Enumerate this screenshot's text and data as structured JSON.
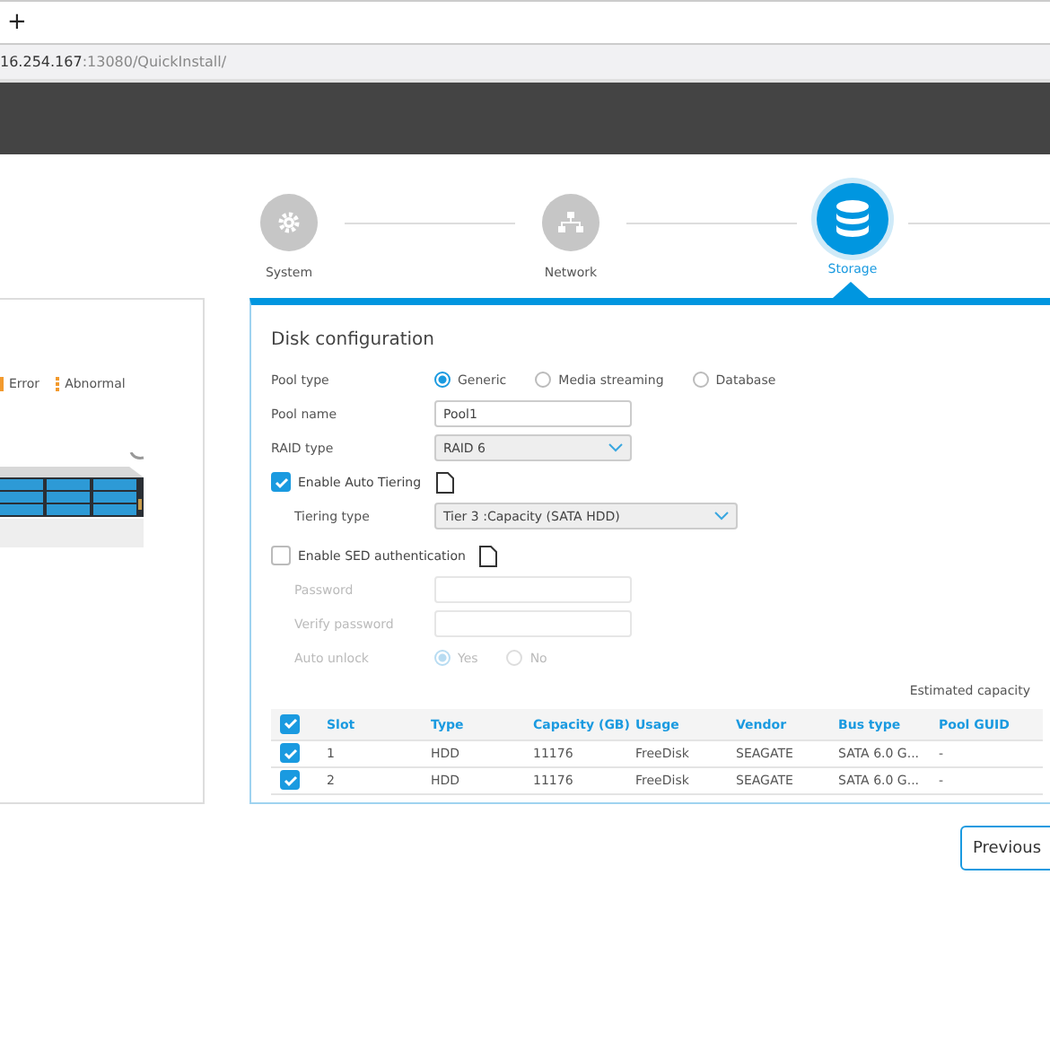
{
  "browser": {
    "new_tab": "+",
    "url_host": "16.254.167",
    "url_path": ":13080/QuickInstall/"
  },
  "steps": [
    {
      "label": "System",
      "kind": "gear",
      "selected": false
    },
    {
      "label": "Network",
      "kind": "network",
      "selected": false
    },
    {
      "label": "Storage",
      "kind": "database",
      "selected": true
    }
  ],
  "legend": [
    {
      "kind": "solid",
      "label": "Error"
    },
    {
      "kind": "striped",
      "label": "Abnormal"
    }
  ],
  "disk_config": {
    "title": "Disk configuration",
    "pool_type": {
      "label": "Pool type",
      "options": [
        {
          "label": "Generic",
          "selected": true
        },
        {
          "label": "Media streaming",
          "selected": false
        },
        {
          "label": "Database",
          "selected": false
        }
      ]
    },
    "pool_name": {
      "label": "Pool name",
      "value": "Pool1"
    },
    "raid_type": {
      "label": "RAID type",
      "value": "RAID 6"
    },
    "auto_tiering": {
      "label": "Enable Auto Tiering",
      "checked": true
    },
    "tiering_type": {
      "label": "Tiering type",
      "value": "Tier 3 :Capacity (SATA HDD)"
    },
    "sed": {
      "label": "Enable SED authentication",
      "checked": false
    },
    "password": {
      "label": "Password",
      "disabled": true
    },
    "verify_password": {
      "label": "Verify password",
      "disabled": true
    },
    "auto_unlock": {
      "label": "Auto unlock",
      "disabled": true,
      "options": [
        {
          "label": "Yes",
          "selected": true
        },
        {
          "label": "No",
          "selected": false
        }
      ]
    },
    "estimated_capacity": "Estimated capacity"
  },
  "disk_table": {
    "all_checked": true,
    "columns": [
      "Slot",
      "Type",
      "Capacity (GB)",
      "Usage",
      "Vendor",
      "Bus type",
      "Pool GUID"
    ],
    "rows": [
      {
        "checked": true,
        "cells": [
          "1",
          "HDD",
          "11176",
          "FreeDisk",
          "SEAGATE",
          "SATA 6.0 G...",
          "-"
        ]
      },
      {
        "checked": true,
        "cells": [
          "2",
          "HDD",
          "11176",
          "FreeDisk",
          "SEAGATE",
          "SATA 6.0 G...",
          "-"
        ]
      }
    ]
  },
  "buttons": [
    {
      "label": "Previous"
    }
  ]
}
